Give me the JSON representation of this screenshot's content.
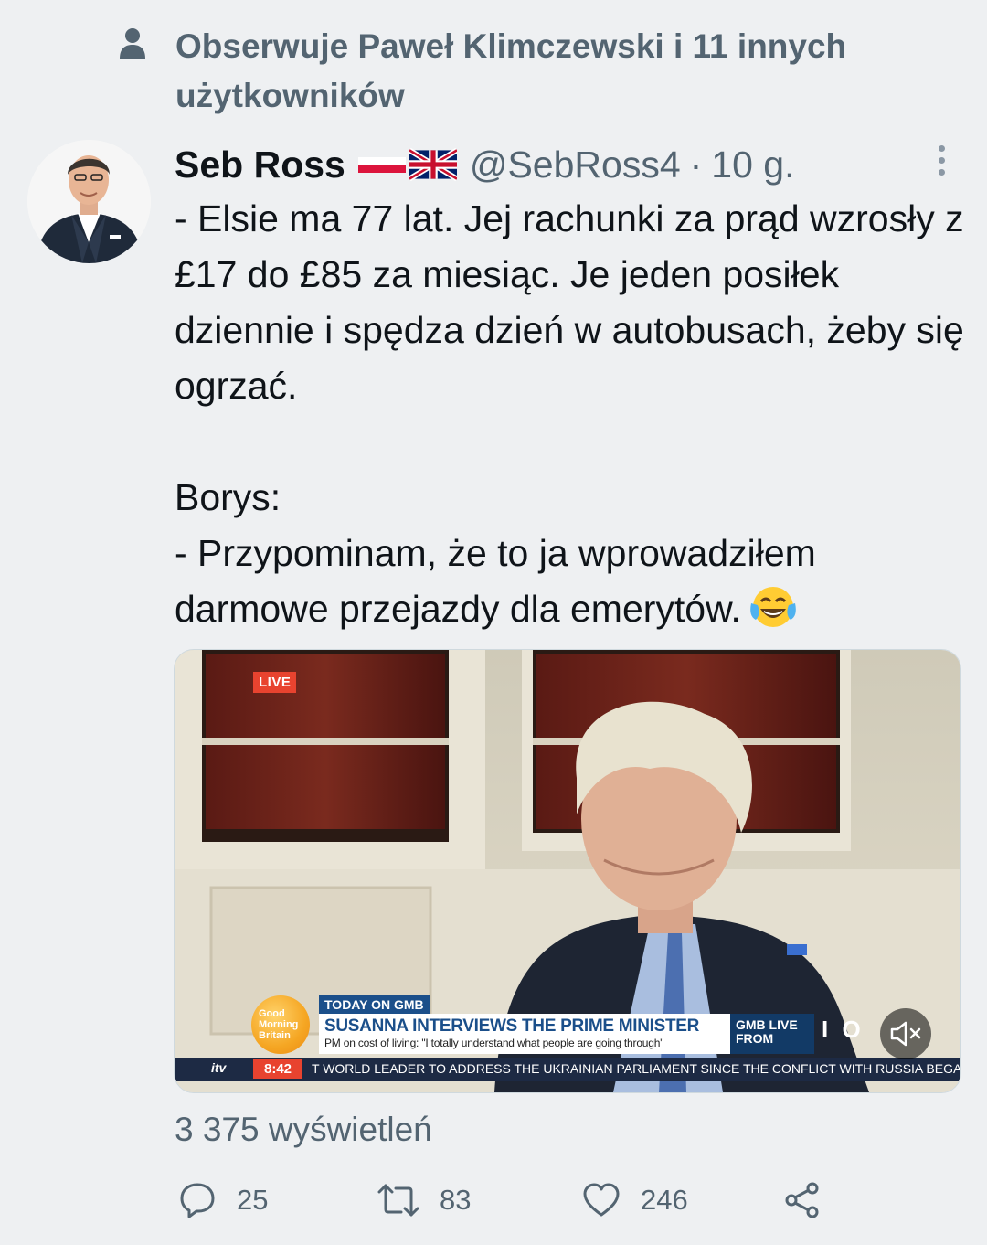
{
  "social_context": {
    "text": "Obserwuje Paweł Klimczewski i 11 innych użytkowników",
    "icon": "person-icon"
  },
  "tweet": {
    "author_name": "Seb Ross",
    "author_flags": [
      "poland-flag",
      "uk-flag"
    ],
    "handle": "@SebRoss4",
    "separator": "·",
    "time": "10 g.",
    "text_paragraphs": [
      "- Elsie ma 77 lat. Jej rachunki za prąd wzrosły z £17 do £85 za miesiąc. Je jeden posiłek dziennie i spędza dzień w autobusach, żeby się ogrzać.",
      "Borys:",
      "- Przypominam, że to ja wprowadziłem darmowe przejazdy dla emerytów."
    ],
    "emoji": "face-with-tears-of-joy",
    "views": "3 375 wyświetleń"
  },
  "video": {
    "live_badge": "LIVE",
    "logo_lines": [
      "Good",
      "Morning",
      "Britain"
    ],
    "today_label": "TODAY ON GMB",
    "headline": "SUSANNA INTERVIEWS THE PRIME MINISTER",
    "subheadline": "PM on cost of living: \"I totally understand what people are going through\"",
    "gmb_live": "GMB LIVE",
    "gmb_from": "FROM",
    "channel_logo": "I O",
    "network": "itv",
    "clock": "8:42",
    "ticker": "T WORLD LEADER TO ADDRESS THE UKRAINIAN PARLIAMENT SINCE THE CONFLICT WITH RUSSIA BEGAN"
  },
  "actions": {
    "replies": "25",
    "retweets": "83",
    "likes": "246"
  },
  "colors": {
    "background": "#eef0f2",
    "secondary_text": "#536471",
    "primary_text": "#0f1419",
    "live_red": "#e8432f",
    "gmb_blue": "#1b4f8a"
  }
}
